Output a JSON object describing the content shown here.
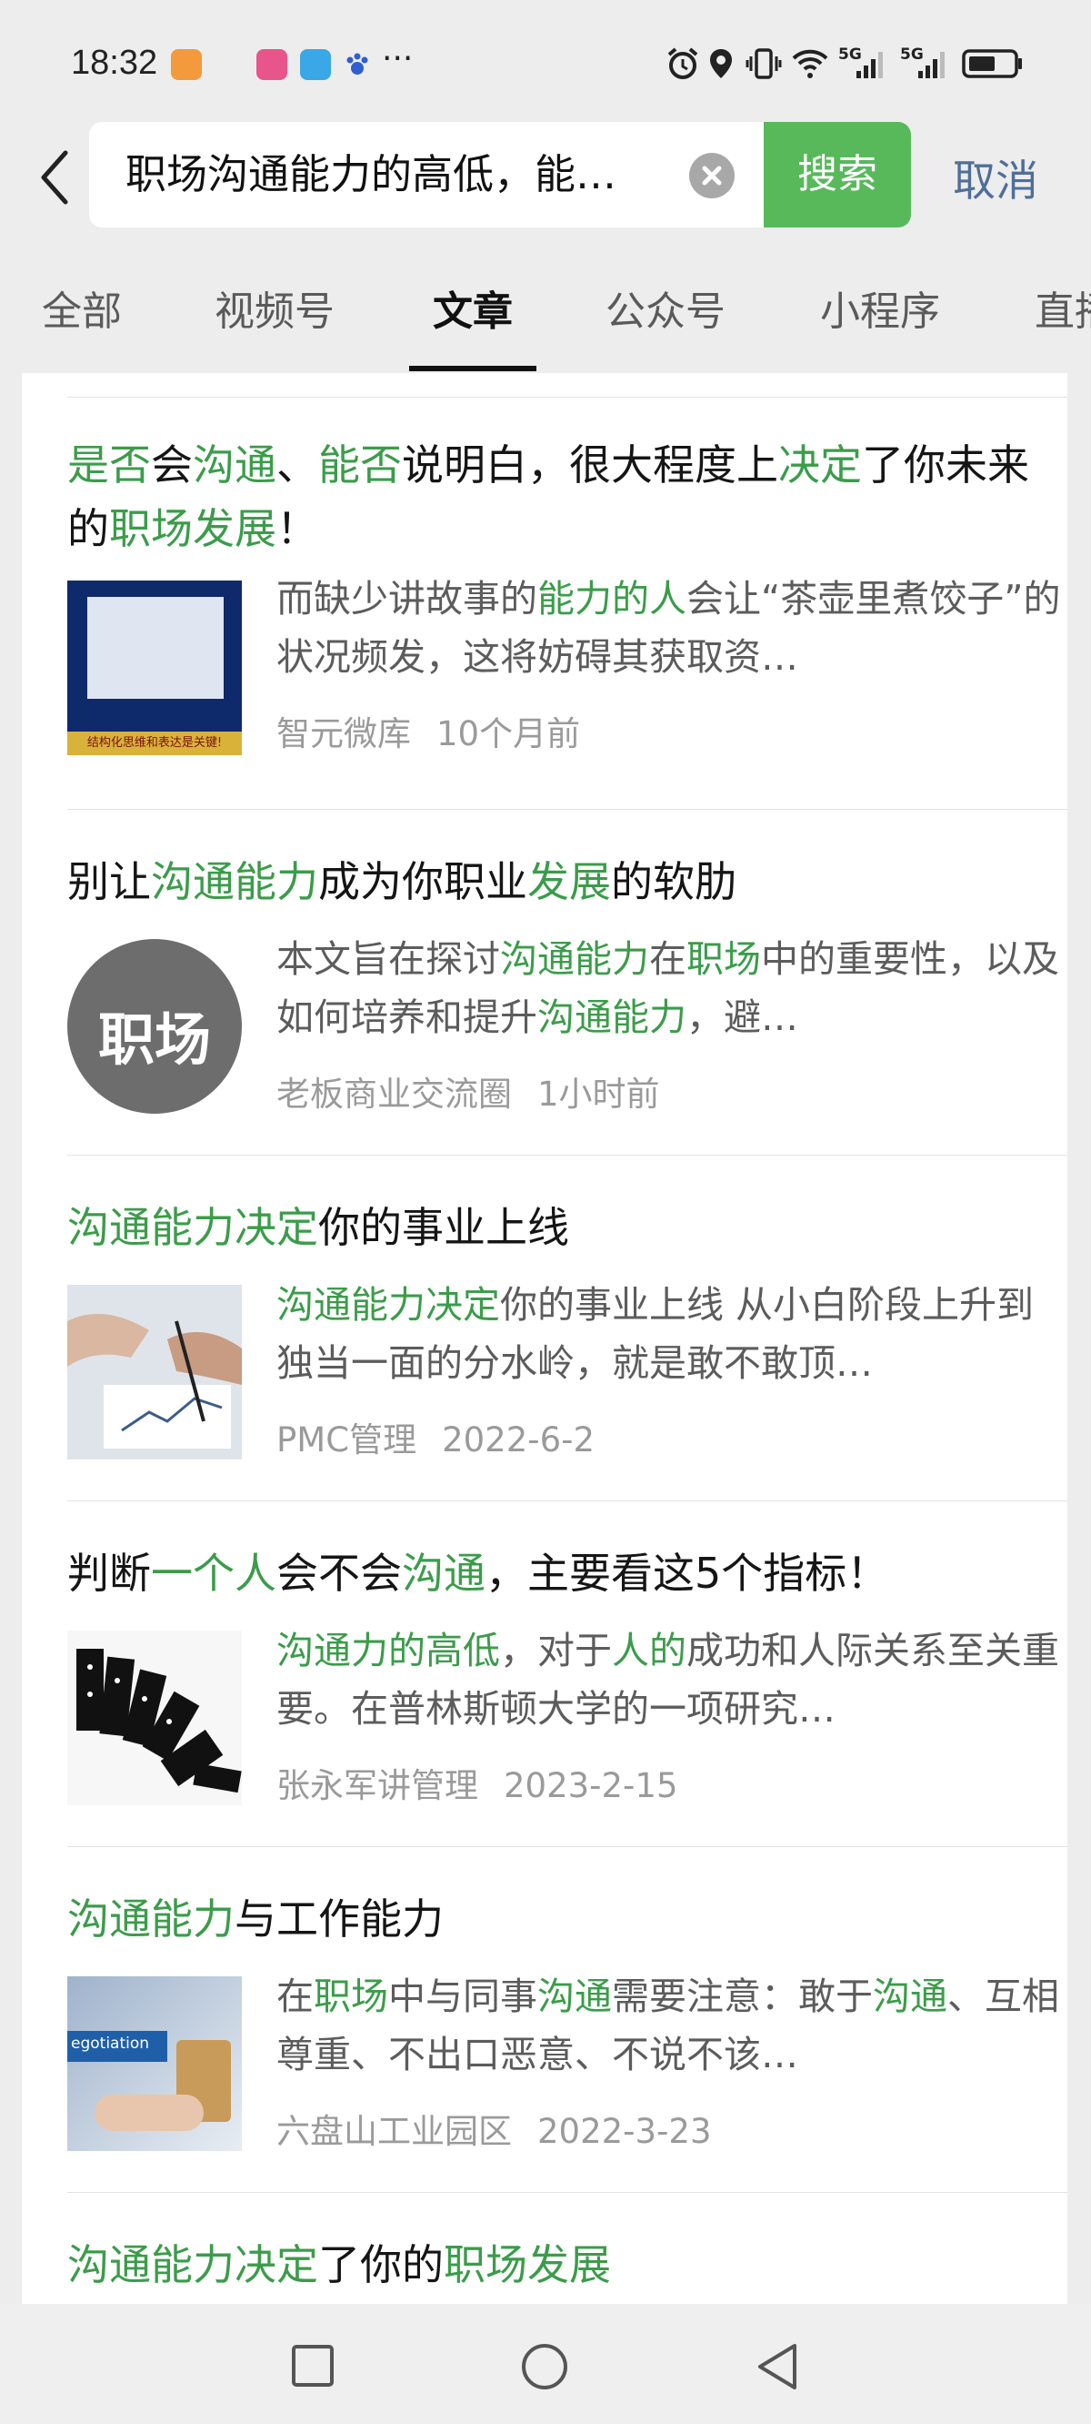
{
  "status_bar": {
    "time": "18:32",
    "more": "···",
    "net1": "5G",
    "net2": "5G",
    "icons": [
      "app-badge-icon",
      "music-app-icon",
      "reader-app-icon",
      "paw-app-icon",
      "alarm-icon",
      "location-icon",
      "vibrate-icon",
      "wifi-icon",
      "signal-icon",
      "signal-icon",
      "battery-icon"
    ]
  },
  "search": {
    "query": "职场沟通能力的高低，能…",
    "button_label": "搜索",
    "cancel_label": "取消"
  },
  "tabs": [
    "全部",
    "视频号",
    "文章",
    "公众号",
    "小程序",
    "直播"
  ],
  "active_tab": "文章",
  "colors": {
    "accent_green": "#58b95b",
    "highlight_green": "#3b9c4a",
    "cancel_blue": "#4f6e99"
  },
  "articles": [
    {
      "title": [
        [
          "是否",
          "g"
        ],
        [
          "会",
          ""
        ],
        [
          "沟通",
          "g"
        ],
        [
          "、",
          ""
        ],
        [
          "能否",
          "g"
        ],
        [
          "说明白，很大程度上",
          ""
        ],
        [
          "决定",
          "g"
        ],
        [
          "了你未来的",
          ""
        ],
        [
          "职场发展",
          "g"
        ],
        [
          "！",
          ""
        ]
      ],
      "desc": [
        [
          "而缺少讲故事的",
          ""
        ],
        [
          "能力的人",
          "g"
        ],
        [
          "会让“茶壶里煮饺子”的状况频发，这将妨碍其获取资…",
          ""
        ]
      ],
      "thumb_kind": "book",
      "thumb_text": "结构化思维和表达是关键!",
      "source": "智元微库",
      "time": "10个月前"
    },
    {
      "title": [
        [
          "别让",
          ""
        ],
        [
          "沟通能力",
          "g"
        ],
        [
          "成为你职业",
          ""
        ],
        [
          "发展",
          "g"
        ],
        [
          "的软肋",
          ""
        ]
      ],
      "desc": [
        [
          "本文旨在探讨",
          ""
        ],
        [
          "沟通能力",
          "g"
        ],
        [
          "在",
          ""
        ],
        [
          "职场",
          "g"
        ],
        [
          "中的重要性，以及如何培养和提升",
          ""
        ],
        [
          "沟通能力",
          "g"
        ],
        [
          "，避…",
          ""
        ]
      ],
      "thumb_kind": "circle",
      "thumb_text": "职场",
      "source": "老板商业交流圈",
      "time": "1小时前"
    },
    {
      "title": [
        [
          "沟通能力决定",
          "g"
        ],
        [
          "你的事业上线",
          ""
        ]
      ],
      "desc": [
        [
          "沟通能力决定",
          "g"
        ],
        [
          "你的事业上线 从小白阶段上升到独当一面的分水岭，就是敢不敢顶…",
          ""
        ]
      ],
      "thumb_kind": "office",
      "thumb_text": "",
      "source": "PMC管理",
      "time": "2022-6-2"
    },
    {
      "title": [
        [
          "判断",
          ""
        ],
        [
          "一个人",
          "g"
        ],
        [
          "会不会",
          ""
        ],
        [
          "沟通",
          "g"
        ],
        [
          "，主要看这5个指标！",
          ""
        ]
      ],
      "desc": [
        [
          "沟通力的高低",
          "g"
        ],
        [
          "，对于",
          ""
        ],
        [
          "人的",
          "g"
        ],
        [
          "成功和人际关系至关重要。在普林斯顿大学的一项研究…",
          ""
        ]
      ],
      "thumb_kind": "dominoes",
      "thumb_text": "",
      "source": "张永军讲管理",
      "time": "2023-2-15"
    },
    {
      "title": [
        [
          "沟通能力",
          "g"
        ],
        [
          "与工作能力",
          ""
        ]
      ],
      "desc": [
        [
          "在",
          ""
        ],
        [
          "职场",
          "g"
        ],
        [
          "中与同事",
          ""
        ],
        [
          "沟通",
          "g"
        ],
        [
          "需要注意：敢于",
          ""
        ],
        [
          "沟通",
          "g"
        ],
        [
          "、互相尊重、不出口恶意、不说不该…",
          ""
        ]
      ],
      "thumb_kind": "negotiation",
      "thumb_text": "egotiation",
      "source": "六盘山工业园区",
      "time": "2022-3-23"
    },
    {
      "title": [
        [
          "沟通能力决定",
          "g"
        ],
        [
          "了你的",
          ""
        ],
        [
          "职场发展",
          "g"
        ]
      ],
      "desc": [],
      "thumb_kind": "none",
      "thumb_text": "",
      "source": "",
      "time": ""
    }
  ],
  "nav_buttons": [
    "recent-apps-icon",
    "home-icon",
    "back-icon"
  ]
}
